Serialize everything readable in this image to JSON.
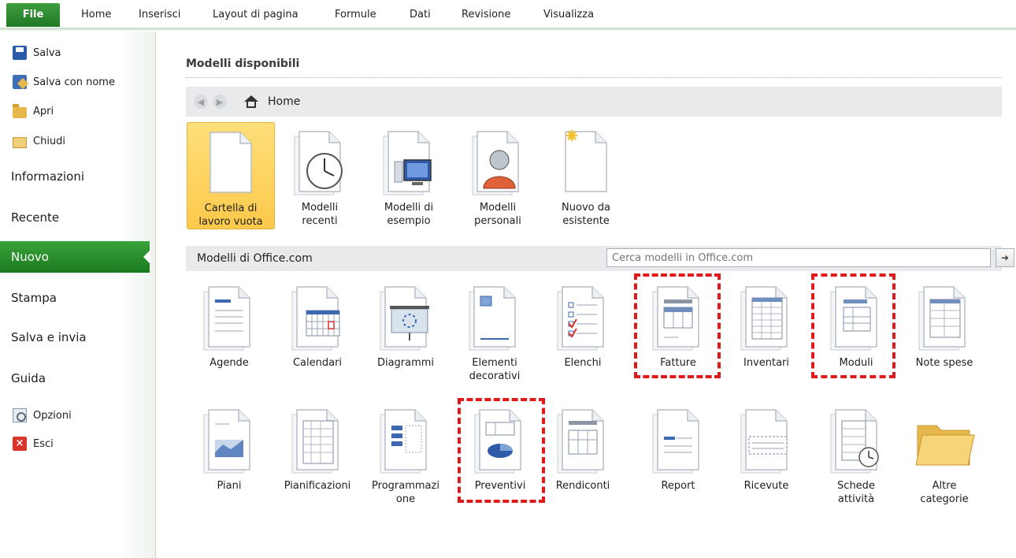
{
  "ribbon": {
    "file_tab": "File",
    "tabs": [
      "Home",
      "Inserisci",
      "Layout di pagina",
      "Formule",
      "Dati",
      "Revisione",
      "Visualizza"
    ]
  },
  "backstage": {
    "commands": [
      {
        "label": "Salva",
        "icon": "save-icon"
      },
      {
        "label": "Salva con nome",
        "icon": "save-as-icon"
      },
      {
        "label": "Apri",
        "icon": "open-folder-icon"
      },
      {
        "label": "Chiudi",
        "icon": "close-folder-icon"
      }
    ],
    "nav": [
      "Informazioni",
      "Recente",
      "Nuovo",
      "Stampa",
      "Salva e invia",
      "Guida"
    ],
    "active_nav": "Nuovo",
    "bottom_commands": [
      {
        "label": "Opzioni",
        "icon": "options-icon"
      },
      {
        "label": "Esci",
        "icon": "exit-icon"
      }
    ]
  },
  "main": {
    "title": "Modelli disponibili",
    "breadcrumb": "Home",
    "templates": [
      {
        "label": "Cartella di\nlavoro vuota",
        "icon": "blank-document-icon",
        "selected": true
      },
      {
        "label": "Modelli\nrecenti",
        "icon": "clock-icon"
      },
      {
        "label": "Modelli di\nesempio",
        "icon": "monitor-icon"
      },
      {
        "label": "Modelli\npersonali",
        "icon": "person-icon"
      },
      {
        "label": "Nuovo da\nesistente",
        "icon": "sparkle-document-icon"
      }
    ],
    "office_title": "Modelli di Office.com",
    "search_placeholder": "Cerca modelli in Office.com",
    "office_row1": [
      {
        "label": "Agende",
        "icon": "agenda-icon"
      },
      {
        "label": "Calendari",
        "icon": "calendar-icon"
      },
      {
        "label": "Diagrammi",
        "icon": "diagram-icon"
      },
      {
        "label": "Elementi\ndecorativi",
        "icon": "decorative-icon"
      },
      {
        "label": "Elenchi",
        "icon": "checklist-icon"
      },
      {
        "label": "Fatture",
        "icon": "invoice-icon"
      },
      {
        "label": "Inventari",
        "icon": "inventory-icon"
      },
      {
        "label": "Moduli",
        "icon": "form-icon"
      },
      {
        "label": "Note spese",
        "icon": "expense-icon"
      }
    ],
    "office_row2": [
      {
        "label": "Piani",
        "icon": "chart-plan-icon"
      },
      {
        "label": "Pianificazioni",
        "icon": "schedule-icon"
      },
      {
        "label": "Programmazi\none",
        "icon": "programming-icon"
      },
      {
        "label": "Preventivi",
        "icon": "quote-pie-icon"
      },
      {
        "label": "Rendiconti",
        "icon": "statement-icon"
      },
      {
        "label": "Report",
        "icon": "report-icon"
      },
      {
        "label": "Ricevute",
        "icon": "receipt-icon"
      },
      {
        "label": "Schede\nattività",
        "icon": "timesheet-icon"
      },
      {
        "label": "Altre\ncategorie",
        "icon": "folder-icon"
      }
    ],
    "highlight_color": "#e01a1a",
    "accent_color": "#1f7a24"
  }
}
